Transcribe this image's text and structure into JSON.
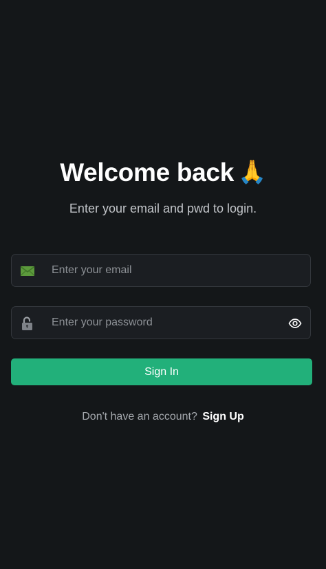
{
  "header": {
    "title": "Welcome back",
    "emoji": "🙏",
    "subtitle": "Enter your email and pwd to login."
  },
  "form": {
    "email": {
      "placeholder": "Enter your email",
      "icon": "envelope-icon"
    },
    "password": {
      "placeholder": "Enter your password",
      "icon": "lock-icon",
      "toggle_icon": "eye-icon"
    },
    "submit_label": "Sign In"
  },
  "footer": {
    "prompt": "Don't have an account?",
    "link_label": "Sign Up"
  },
  "colors": {
    "background": "#141719",
    "field_background": "#1b1e22",
    "accent": "#22b07a"
  }
}
